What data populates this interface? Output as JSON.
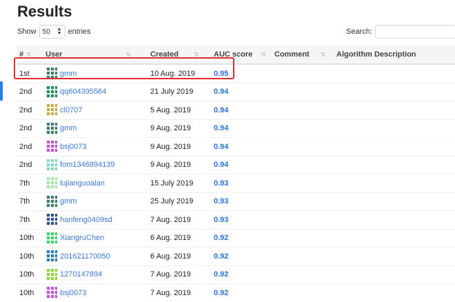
{
  "page": {
    "title": "Results"
  },
  "length_control": {
    "show_label": "Show",
    "selected": "50",
    "entries_label": "entries"
  },
  "search": {
    "label": "Search:",
    "value": ""
  },
  "columns": [
    "#",
    "User",
    "Created",
    "AUC score",
    "Comment",
    "Algorithm Description"
  ],
  "rows": [
    {
      "rank": "1st",
      "user": "gmm",
      "created": "10 Aug. 2019",
      "score": "0.95",
      "avatar_color": "#3a7a6a"
    },
    {
      "rank": "2nd",
      "user": "qq604395564",
      "created": "21 July 2019",
      "score": "0.94",
      "avatar_color": "#1e8f5a"
    },
    {
      "rank": "2nd",
      "user": "cl0707",
      "created": "5 Aug. 2019",
      "score": "0.94",
      "avatar_color": "#c9a84a"
    },
    {
      "rank": "2nd",
      "user": "gmm",
      "created": "9 Aug. 2019",
      "score": "0.94",
      "avatar_color": "#3a7a6a"
    },
    {
      "rank": "2nd",
      "user": "bsj0073",
      "created": "9 Aug. 2019",
      "score": "0.94",
      "avatar_color": "#c24fd6"
    },
    {
      "rank": "2nd",
      "user": "fom1346894139",
      "created": "9 Aug. 2019",
      "score": "0.94",
      "avatar_color": "#7fd6c4"
    },
    {
      "rank": "7th",
      "user": "lujianguoalan",
      "created": "15 July 2019",
      "score": "0.93",
      "avatar_color": "#a8e6a8"
    },
    {
      "rank": "7th",
      "user": "gmm",
      "created": "25 July 2019",
      "score": "0.93",
      "avatar_color": "#3a7a6a"
    },
    {
      "rank": "7th",
      "user": "hanfeng0409sd",
      "created": "7 Aug. 2019",
      "score": "0.93",
      "avatar_color": "#2d4f8a"
    },
    {
      "rank": "10th",
      "user": "XiangruChen",
      "created": "6 Aug. 2019",
      "score": "0.92",
      "avatar_color": "#3ad66a"
    },
    {
      "rank": "10th",
      "user": "201621170050",
      "created": "6 Aug. 2019",
      "score": "0.92",
      "avatar_color": "#2b7ab8"
    },
    {
      "rank": "10th",
      "user": "1270147894",
      "created": "7 Aug. 2019",
      "score": "0.92",
      "avatar_color": "#8cd63a"
    },
    {
      "rank": "10th",
      "user": "bsj0073",
      "created": "7 Aug. 2019",
      "score": "0.92",
      "avatar_color": "#c24fd6"
    }
  ],
  "colors": {
    "link": "#3a7bd5",
    "score": "#2b6fd6",
    "highlight": "#e02b2b",
    "active_marker": "#2b7de9"
  }
}
